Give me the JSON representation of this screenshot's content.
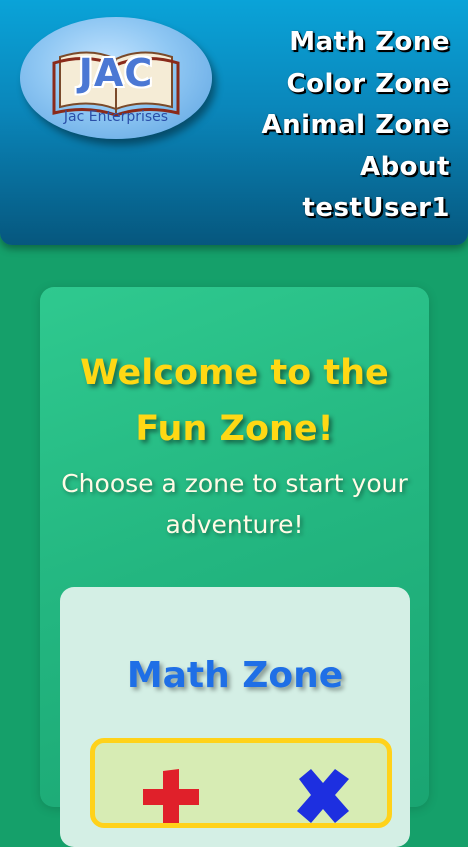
{
  "header": {
    "logo": {
      "main_text": "JAC",
      "sub_text": "Jac Enterprises"
    },
    "nav": [
      {
        "label": "Math Zone"
      },
      {
        "label": "Color Zone"
      },
      {
        "label": "Animal Zone"
      },
      {
        "label": "About"
      },
      {
        "label": "testUser1"
      }
    ]
  },
  "main": {
    "welcome_title": "Welcome to the Fun Zone!",
    "subtitle": "Choose a zone to start your adventure!",
    "zones": [
      {
        "title": "Math Zone",
        "preview_icons": [
          "plus-icon",
          "times-icon"
        ]
      }
    ]
  },
  "colors": {
    "background": "#15a06a",
    "header_top": "#0aa3d8",
    "header_bottom": "#06577e",
    "welcome_yellow": "#ffd814",
    "zone_title_blue": "#1f6fe6",
    "preview_border": "#ffd21a",
    "plus_red": "#e0202a",
    "times_blue": "#1d2fe0"
  }
}
